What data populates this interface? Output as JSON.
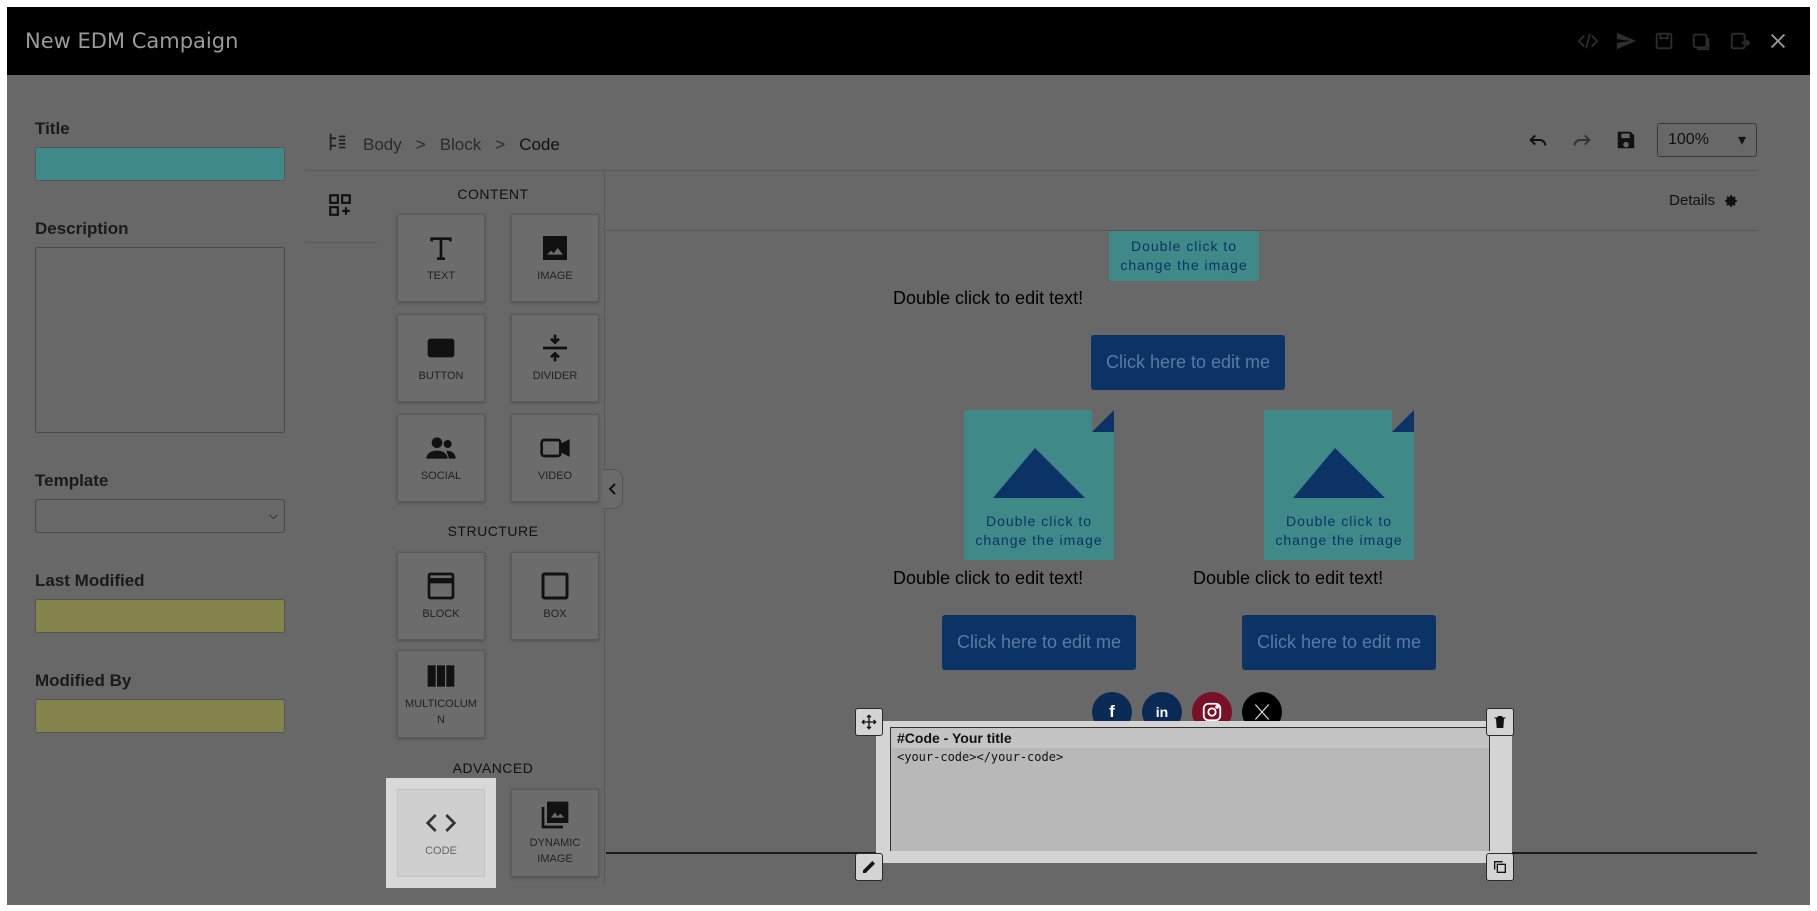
{
  "window": {
    "title": "New EDM Campaign"
  },
  "titlebar_icons": [
    "code-icon",
    "send-icon",
    "save-icon",
    "save-as-icon",
    "export-icon",
    "close-icon"
  ],
  "form": {
    "title_label": "Title",
    "title_value": "",
    "description_label": "Description",
    "description_value": "",
    "template_label": "Template",
    "template_value": "",
    "last_modified_label": "Last Modified",
    "last_modified_value": "",
    "modified_by_label": "Modified By",
    "modified_by_value": ""
  },
  "breadcrumb": [
    "Body",
    "Block",
    "Code"
  ],
  "breadcrumb_separator": ">",
  "toolbar": {
    "zoom": "100%"
  },
  "panel": {
    "content_heading": "CONTENT",
    "structure_heading": "STRUCTURE",
    "advanced_heading": "ADVANCED",
    "content": [
      "TEXT",
      "IMAGE",
      "BUTTON",
      "DIVIDER",
      "SOCIAL",
      "VIDEO"
    ],
    "structure": [
      "BLOCK",
      "BOX",
      "MULTICOLUM\nN"
    ],
    "advanced": [
      "CODE",
      "DYNAMIC IMAGE"
    ]
  },
  "canvas": {
    "details_label": "Details",
    "image_placeholder_line1": "Double click to",
    "image_placeholder_line2": "change the image",
    "edit_text": "Double click to edit text!",
    "button_text": "Click here to edit me"
  },
  "code_block": {
    "title": "#Code - Your title",
    "body": "<your-code></your-code>"
  },
  "colors": {
    "overlay": "#686868",
    "titlebar": "#000000",
    "button_bg": "#0c3366",
    "image_bg": "#3f8a89",
    "facebook": "#0a2a55",
    "linkedin": "#0a2a55",
    "instagram": "#7a0f28",
    "x": "#000000"
  }
}
